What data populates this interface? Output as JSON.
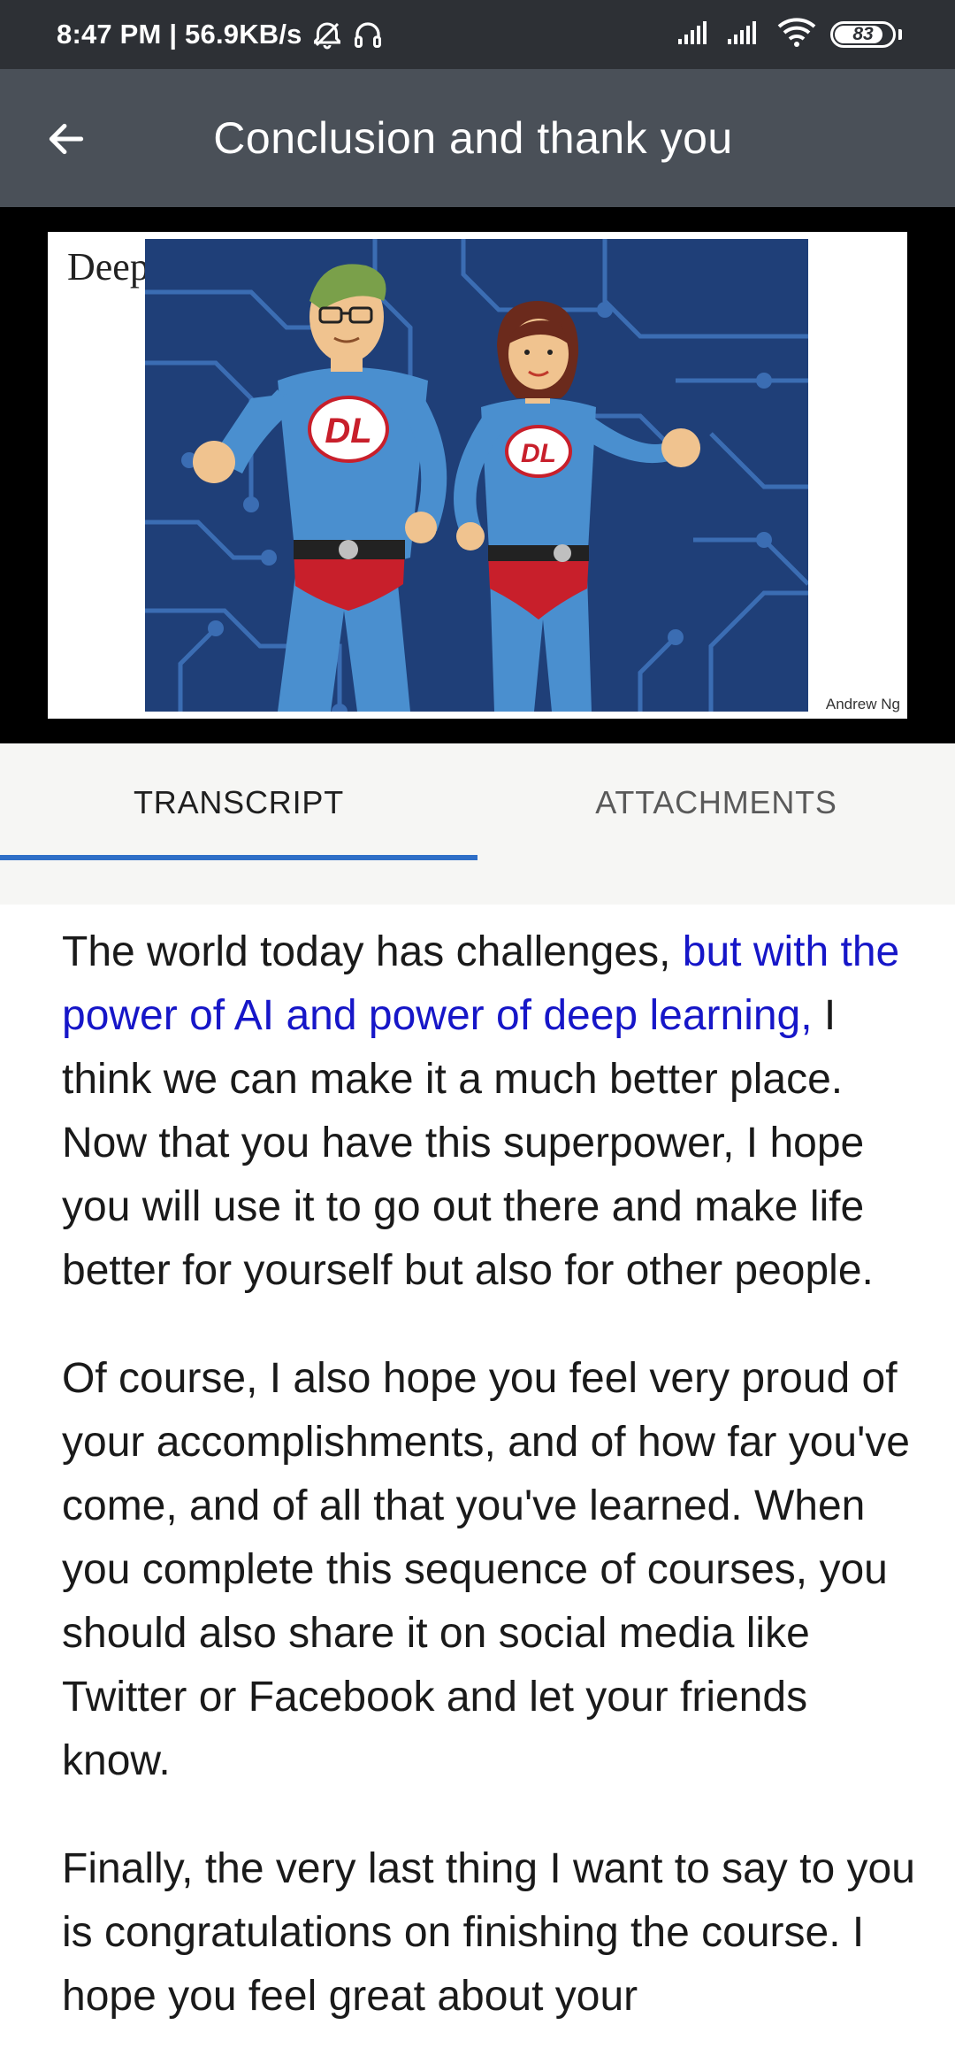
{
  "status_bar": {
    "time_speed": "8:47 PM | 56.9KB/s",
    "battery_level": "83",
    "icons": [
      "alarm-off-icon",
      "headset-icon",
      "signal-icon",
      "signal-icon",
      "wifi-icon",
      "battery-icon"
    ]
  },
  "app_bar": {
    "title": "Conclusion and thank you",
    "back_icon": "back-arrow-icon"
  },
  "video": {
    "slide_title": "Deep",
    "chest_left": "DL",
    "chest_right": "DL",
    "credit": "Andrew Ng"
  },
  "tabs": [
    {
      "label": "TRANSCRIPT",
      "selected": true
    },
    {
      "label": "ATTACHMENTS",
      "selected": false
    }
  ],
  "transcript": {
    "p1_before": "The world today has challenges, ",
    "p1_highlight": "but with the power of AI and power of deep learning,",
    "p1_after": " I think we can make it a much better place. Now that you have this superpower, I hope you will use it to go out there and make life better for yourself but also for other people.",
    "p2": "Of course, I also hope you feel very proud of your accomplishments, and of how far you've come, and of all that you've learned. When you complete this sequence of courses, you should also share it on social media like Twitter or Facebook and let your friends know.",
    "p3": "Finally, the very last thing I want to say to you is congratulations on finishing the course. I hope you feel great about your"
  },
  "colors": {
    "status_bar": "#2d3035",
    "app_bar": "#4a5058",
    "tab_indicator": "#2f6fc7",
    "highlight_text": "#1616c8"
  }
}
